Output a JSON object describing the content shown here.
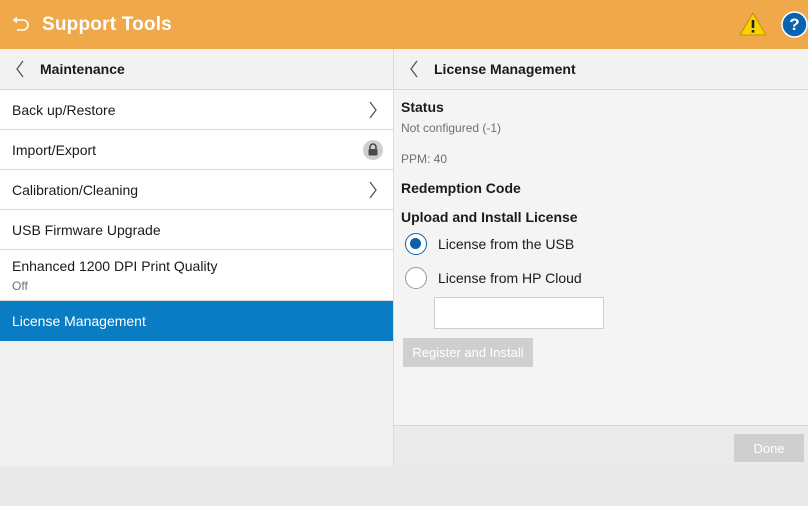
{
  "app": {
    "title": "Support Tools"
  },
  "left": {
    "header": "Maintenance",
    "items": [
      {
        "label": "Back up/Restore"
      },
      {
        "label": "Import/Export"
      },
      {
        "label": "Calibration/Cleaning"
      },
      {
        "label": "USB Firmware Upgrade"
      },
      {
        "label": "Enhanced 1200 DPI Print Quality",
        "value": "Off"
      },
      {
        "label": "License Management"
      }
    ]
  },
  "right": {
    "header": "License Management",
    "status_label": "Status",
    "status_value": "Not configured (-1)",
    "ppm": "PPM: 40",
    "redemption_label": "Redemption Code",
    "upload_label": "Upload and Install License",
    "options": [
      {
        "label": "License from the USB",
        "selected": true
      },
      {
        "label": "License from HP Cloud",
        "selected": false
      }
    ],
    "cloud_input_value": "",
    "register_label": "Register and Install",
    "done_label": "Done"
  },
  "colors": {
    "header": "#efa94a",
    "selected": "#0a7cc3",
    "radio": "#0a5fa8"
  }
}
